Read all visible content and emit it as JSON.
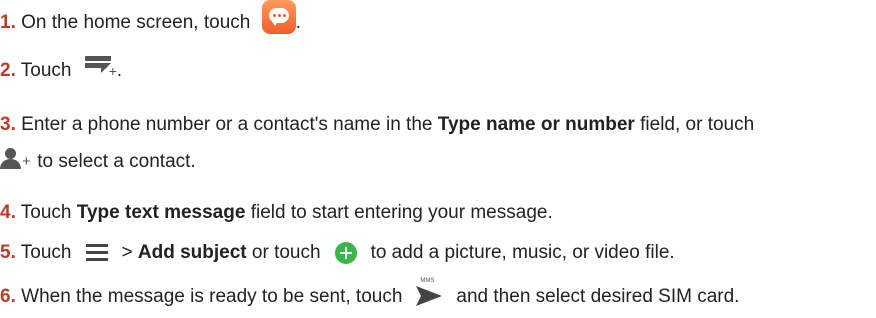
{
  "steps": [
    {
      "num": "1.",
      "text_before": "On the home screen, touch",
      "text_after": ".",
      "icon": "messaging-app-icon"
    },
    {
      "num": "2.",
      "text_before": "Touch",
      "text_after": ".",
      "icon": "new-message-icon"
    },
    {
      "num": "3.",
      "text_before": "Enter a phone number or a contact's name in the",
      "bold": "Type name or number",
      "text_after": "field, or touch",
      "line2": "to select a contact.",
      "icon": "add-contact-icon"
    },
    {
      "num": "4.",
      "text_before": "Touch",
      "bold": "Type text message",
      "text_after": "field to start entering your message."
    },
    {
      "num": "5.",
      "text_before": "Touch",
      "sep": ">",
      "bold": "Add subject",
      "mid": "or touch",
      "text_after": "to add a picture, music, or video file.",
      "icons": [
        "menu-icon",
        "add-circle-icon"
      ]
    },
    {
      "num": "6.",
      "text_before": "When the message is ready to be sent, touch",
      "text_after": "and then select desired SIM card.",
      "icon": "send-mms-icon",
      "icon_label": "MMS"
    }
  ],
  "colors": {
    "step_number": "#c0392b",
    "text": "#222222",
    "app_icon": "#f35c2a",
    "add_icon": "#3ab54a"
  }
}
